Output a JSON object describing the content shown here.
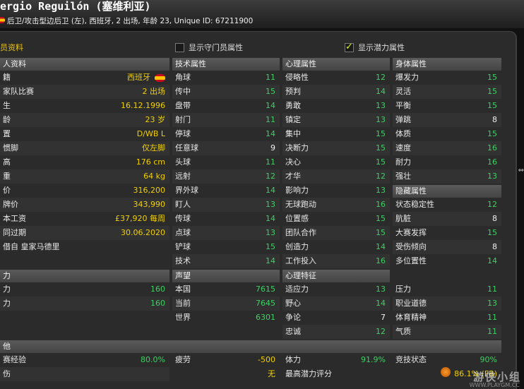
{
  "header": {
    "name": "ergio Reguilón (塞维利亚)",
    "subline": "后卫/攻击型边后卫 (左), 西班牙, 2 出场, 年龄 23, Unique ID: 67211900"
  },
  "toolbar": {
    "title": "员资料",
    "gk_toggle_label": "显示守门员属性",
    "potential_toggle_label": "显示潜力属性",
    "potential_checked": true
  },
  "personal": {
    "title": "人资料",
    "rows": [
      {
        "label": "籍",
        "value": "西班牙",
        "color": "y",
        "flag": true
      },
      {
        "label": "家队比赛",
        "value": "2 出场",
        "color": "y"
      },
      {
        "label": "生",
        "value": "16.12.1996",
        "color": "y"
      },
      {
        "label": "龄",
        "value": "23 岁",
        "color": "y"
      },
      {
        "label": "置",
        "value": "D/WB L",
        "color": "y"
      },
      {
        "label": "惯脚",
        "value": "仅左脚",
        "color": "y"
      },
      {
        "label": "高",
        "value": "176 cm",
        "color": "y"
      },
      {
        "label": "重",
        "value": "64 kg",
        "color": "y"
      },
      {
        "label": "价",
        "value": "316,200",
        "color": "y"
      },
      {
        "label": "牌价",
        "value": "343,990",
        "color": "y"
      },
      {
        "label": "本工资",
        "value": "£37,920 每周",
        "color": "y"
      },
      {
        "label": "同过期",
        "value": "30.06.2020",
        "color": "y"
      }
    ],
    "loan_label": "借自 皇家马德里"
  },
  "ability": {
    "title": "力",
    "rows": [
      {
        "label": "力",
        "value": "160"
      },
      {
        "label": "力",
        "value": "160"
      }
    ]
  },
  "other": {
    "title": "他",
    "rows": [
      {
        "label": "赛经验",
        "value": "80.0%",
        "color": "g"
      },
      {
        "label": "伤",
        "value": "",
        "color": "g"
      }
    ]
  },
  "technical": {
    "title": "技术属性",
    "rows": [
      {
        "label": "角球",
        "value": "11",
        "color": "g"
      },
      {
        "label": "传中",
        "value": "15",
        "color": "g"
      },
      {
        "label": "盘带",
        "value": "14",
        "color": "g"
      },
      {
        "label": "射门",
        "value": "11",
        "color": "g"
      },
      {
        "label": "停球",
        "value": "14",
        "color": "g"
      },
      {
        "label": "任意球",
        "value": "9",
        "color": "w"
      },
      {
        "label": "头球",
        "value": "11",
        "color": "g"
      },
      {
        "label": "远射",
        "value": "12",
        "color": "g"
      },
      {
        "label": "界外球",
        "value": "14",
        "color": "g"
      },
      {
        "label": "盯人",
        "value": "13",
        "color": "g"
      },
      {
        "label": "传球",
        "value": "14",
        "color": "g"
      },
      {
        "label": "点球",
        "value": "13",
        "color": "g"
      },
      {
        "label": "铲球",
        "value": "15",
        "color": "g"
      },
      {
        "label": "技术",
        "value": "14",
        "color": "g"
      }
    ]
  },
  "reputation": {
    "title": "声望",
    "rows": [
      {
        "label": "本国",
        "value": "7615",
        "color": "g"
      },
      {
        "label": "当前",
        "value": "7645",
        "color": "g"
      },
      {
        "label": "世界",
        "value": "6301",
        "color": "g"
      }
    ]
  },
  "fatigue": {
    "label": "疲劳",
    "value": "-500",
    "color": "y"
  },
  "none_value": {
    "value": "无",
    "color": "y"
  },
  "mental": {
    "title": "心理属性",
    "rows": [
      {
        "label": "侵略性",
        "value": "12",
        "color": "g"
      },
      {
        "label": "预判",
        "value": "14",
        "color": "g"
      },
      {
        "label": "勇敢",
        "value": "13",
        "color": "g"
      },
      {
        "label": "镇定",
        "value": "13",
        "color": "g"
      },
      {
        "label": "集中",
        "value": "15",
        "color": "g"
      },
      {
        "label": "决断力",
        "value": "15",
        "color": "g"
      },
      {
        "label": "决心",
        "value": "15",
        "color": "g"
      },
      {
        "label": "才华",
        "value": "12",
        "color": "g"
      },
      {
        "label": "影响力",
        "value": "13",
        "color": "g"
      },
      {
        "label": "无球跑动",
        "value": "16",
        "color": "g"
      },
      {
        "label": "位置感",
        "value": "15",
        "color": "g"
      },
      {
        "label": "团队合作",
        "value": "15",
        "color": "g"
      },
      {
        "label": "创造力",
        "value": "14",
        "color": "g"
      },
      {
        "label": "工作投入",
        "value": "16",
        "color": "g"
      }
    ]
  },
  "mental_traits": {
    "title": "心理特征",
    "rows": [
      {
        "label": "适应力",
        "value": "13",
        "color": "g"
      },
      {
        "label": "野心",
        "value": "14",
        "color": "g"
      },
      {
        "label": "争论",
        "value": "7",
        "color": "w"
      },
      {
        "label": "忠诚",
        "value": "12",
        "color": "g"
      }
    ]
  },
  "stamina": {
    "label": "体力",
    "value": "91.9%",
    "color": "g"
  },
  "max_potential": {
    "label": "最高潜力评分"
  },
  "physical": {
    "title": "身体属性",
    "rows": [
      {
        "label": "爆发力",
        "value": "15",
        "color": "g"
      },
      {
        "label": "灵活",
        "value": "15",
        "color": "g"
      },
      {
        "label": "平衡",
        "value": "15",
        "color": "g"
      },
      {
        "label": "弹跳",
        "value": "8",
        "color": "w"
      },
      {
        "label": "体质",
        "value": "15",
        "color": "g"
      },
      {
        "label": "速度",
        "value": "16",
        "color": "g"
      },
      {
        "label": "耐力",
        "value": "16",
        "color": "g"
      },
      {
        "label": "强壮",
        "value": "13",
        "color": "g"
      }
    ]
  },
  "hidden": {
    "title": "隐藏属性",
    "rows": [
      {
        "label": "状态稳定性",
        "value": "12",
        "color": "g"
      },
      {
        "label": "肮脏",
        "value": "8",
        "color": "w"
      },
      {
        "label": "大赛发挥",
        "value": "15",
        "color": "g"
      },
      {
        "label": "受伤倾向",
        "value": "8",
        "color": "w"
      },
      {
        "label": "多位置性",
        "value": "14",
        "color": "g"
      }
    ]
  },
  "pressure": {
    "rows": [
      {
        "label": "压力",
        "value": "11",
        "color": "g"
      },
      {
        "label": "职业道德",
        "value": "13",
        "color": "g"
      },
      {
        "label": "体育精神",
        "value": "11",
        "color": "g"
      },
      {
        "label": "气质",
        "value": "11",
        "color": "g"
      }
    ]
  },
  "form": {
    "label": "竞技状态",
    "value": "90%",
    "color": "g"
  },
  "potential_rating": {
    "value": "86.1% (FB)",
    "color": "y"
  },
  "watermark": {
    "text": "游侠小组",
    "sub": "WWW.PLAYGM.CC"
  }
}
